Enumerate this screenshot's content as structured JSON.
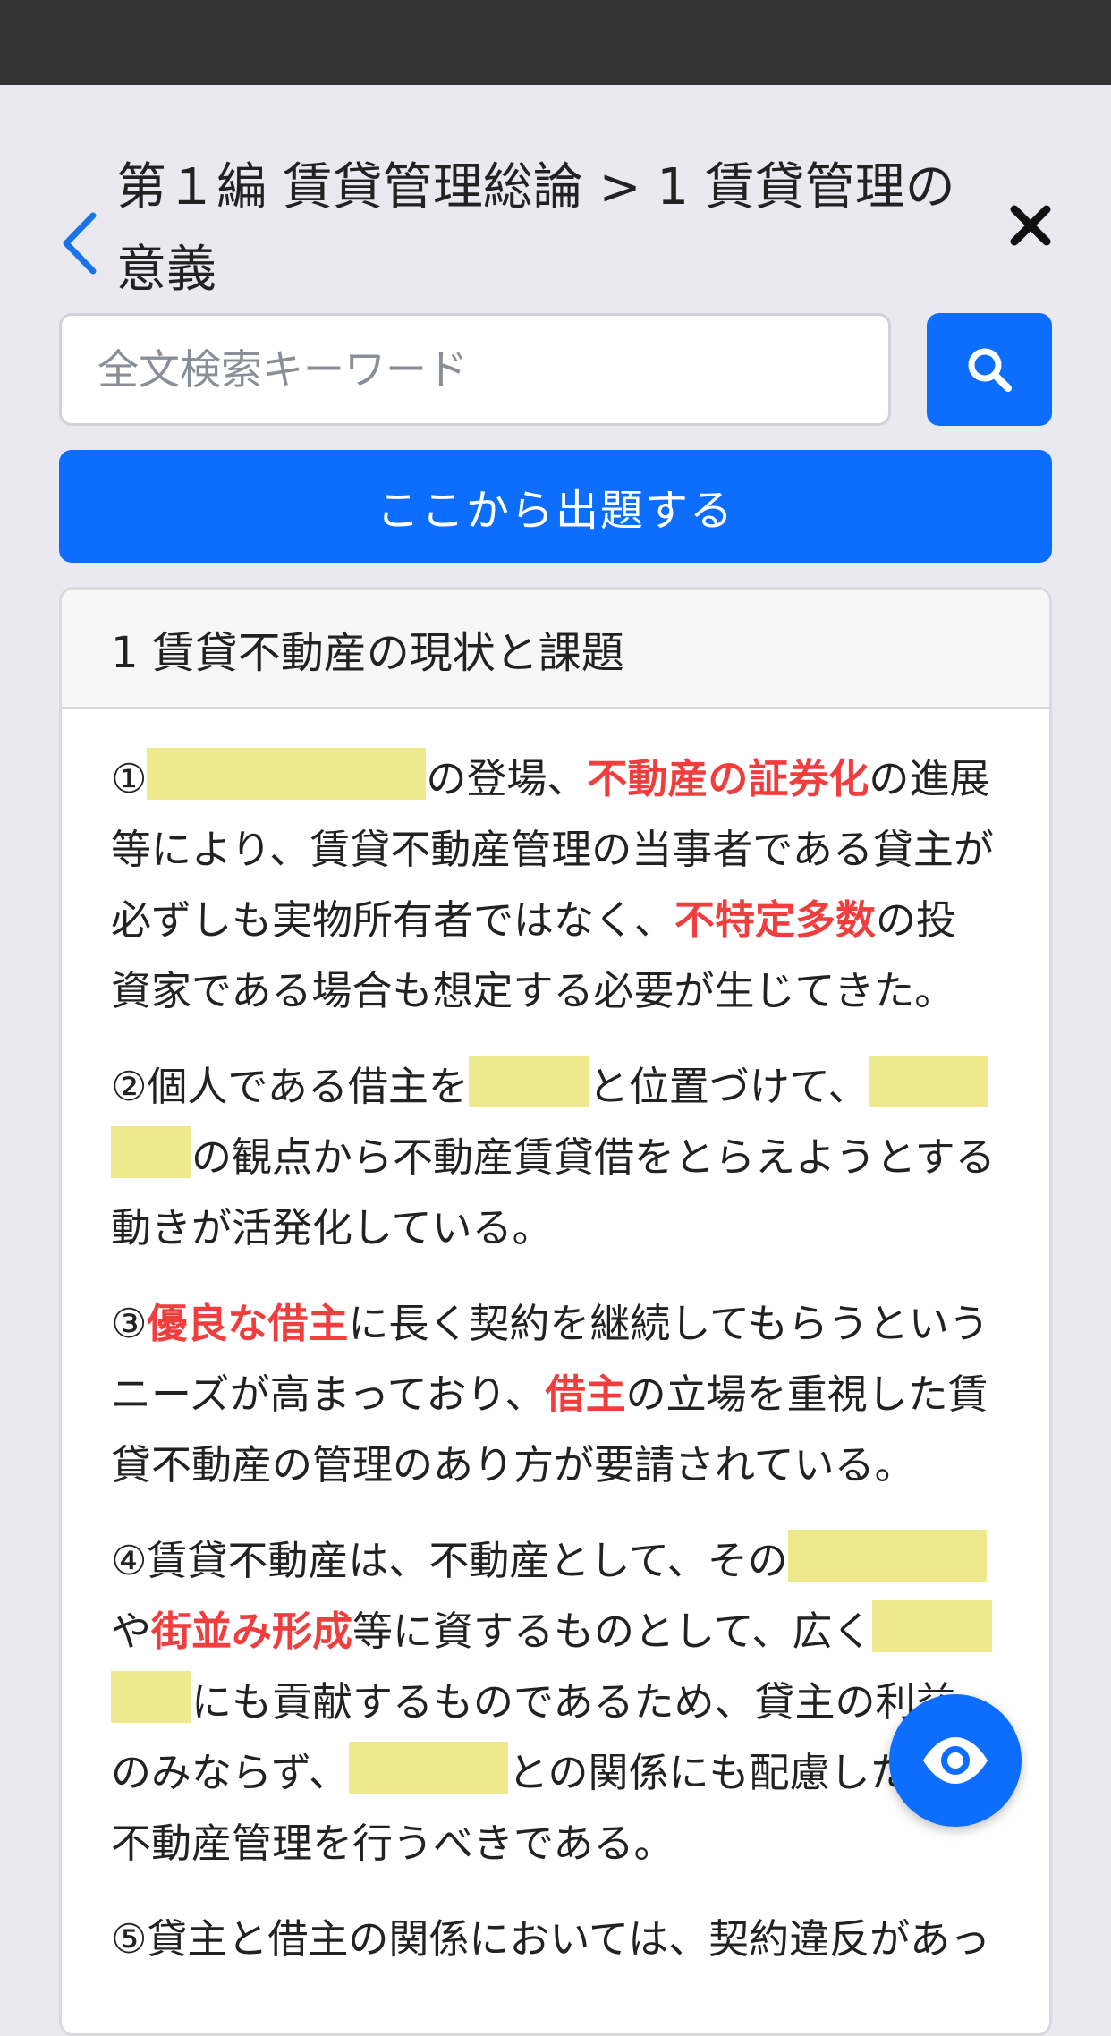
{
  "header": {
    "title": "第１編 賃貸管理総論 > 1 賃貸管理の意義"
  },
  "search": {
    "placeholder": "全文検索キーワード"
  },
  "quiz_button": {
    "label": "ここから出題する"
  },
  "section": {
    "title": "1 賃貸不動産の現状と課題",
    "items": [
      {
        "p1": "①",
        "p2": "の登場、",
        "r1": "不動産の証券化",
        "p3": "の進展等により、賃貸不動産管理の当事者である貸主が必ずしも実物所有者ではなく、",
        "r2": "不特定多数",
        "p4": "の投資家である場合も想定する必要が生じてきた。"
      },
      {
        "p1": "②個人である借主を",
        "p2": "と位置づけて、",
        "p3": "の観点から不動産賃貸借をとらえようとする動きが活発化している。"
      },
      {
        "p1": "③",
        "r1": "優良な借主",
        "p2": "に長く契約を継続してもらうというニーズが高まっており、",
        "r2": "借主",
        "p3": "の立場を重視した賃貸不動産の管理のあり方が要請されている。"
      },
      {
        "p1": "④賃貸不動産は、不動産として、その",
        "p2": "や",
        "r1": "街並み形成",
        "p3": "等に資するものとして、広く",
        "p4": "にも貢献するものであるため、貸主の利益のみならず、",
        "p5": "との関係にも配慮した賃貸不動産管理を行うべきである。"
      },
      {
        "p1": "⑤貸主と借主の関係においては、契約違反があっ"
      }
    ]
  },
  "icons": {
    "back": "chevron-left-icon",
    "close": "close-icon",
    "search": "search-icon",
    "eye": "eye-icon"
  },
  "colors": {
    "primary": "#0d6efd",
    "highlight_red": "#f03e3e",
    "blank_fill": "#ede98c",
    "status_bar": "#333333",
    "background": "#e9e9ef"
  }
}
